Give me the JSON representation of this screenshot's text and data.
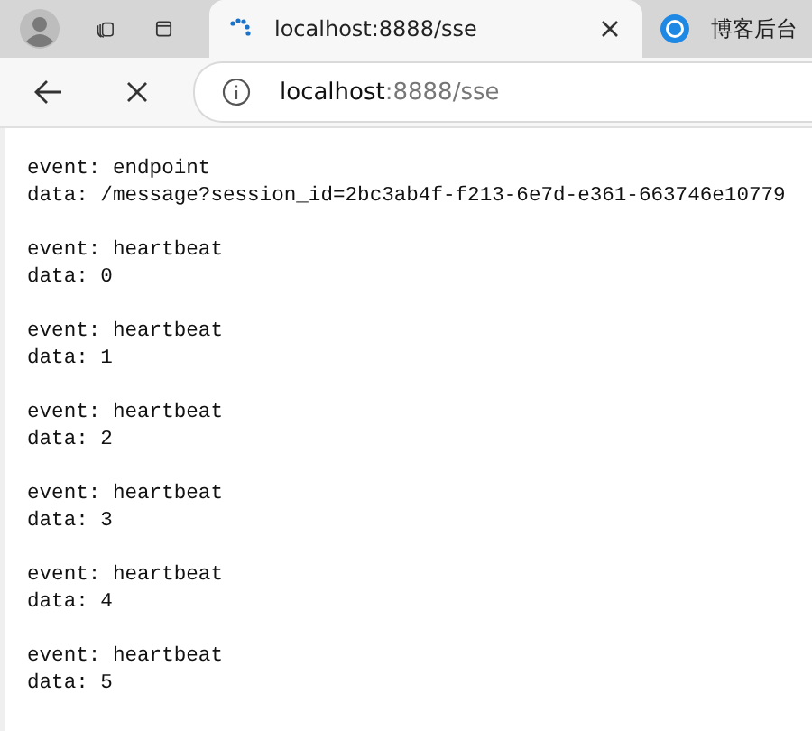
{
  "tabs": [
    {
      "title": "localhost:8888/sse",
      "selected": true,
      "loading": true
    },
    {
      "title": "博客后台",
      "selected": false,
      "loading": false
    }
  ],
  "address_bar": {
    "host": "localhost",
    "rest": ":8888/sse"
  },
  "events": [
    {
      "event": "event: endpoint",
      "data": "data: /message?session_id=2bc3ab4f-f213-6e7d-e361-663746e10779"
    },
    {
      "event": "event: heartbeat",
      "data": "data: 0"
    },
    {
      "event": "event: heartbeat",
      "data": "data: 1"
    },
    {
      "event": "event: heartbeat",
      "data": "data: 2"
    },
    {
      "event": "event: heartbeat",
      "data": "data: 3"
    },
    {
      "event": "event: heartbeat",
      "data": "data: 4"
    },
    {
      "event": "event: heartbeat",
      "data": "data: 5"
    }
  ]
}
